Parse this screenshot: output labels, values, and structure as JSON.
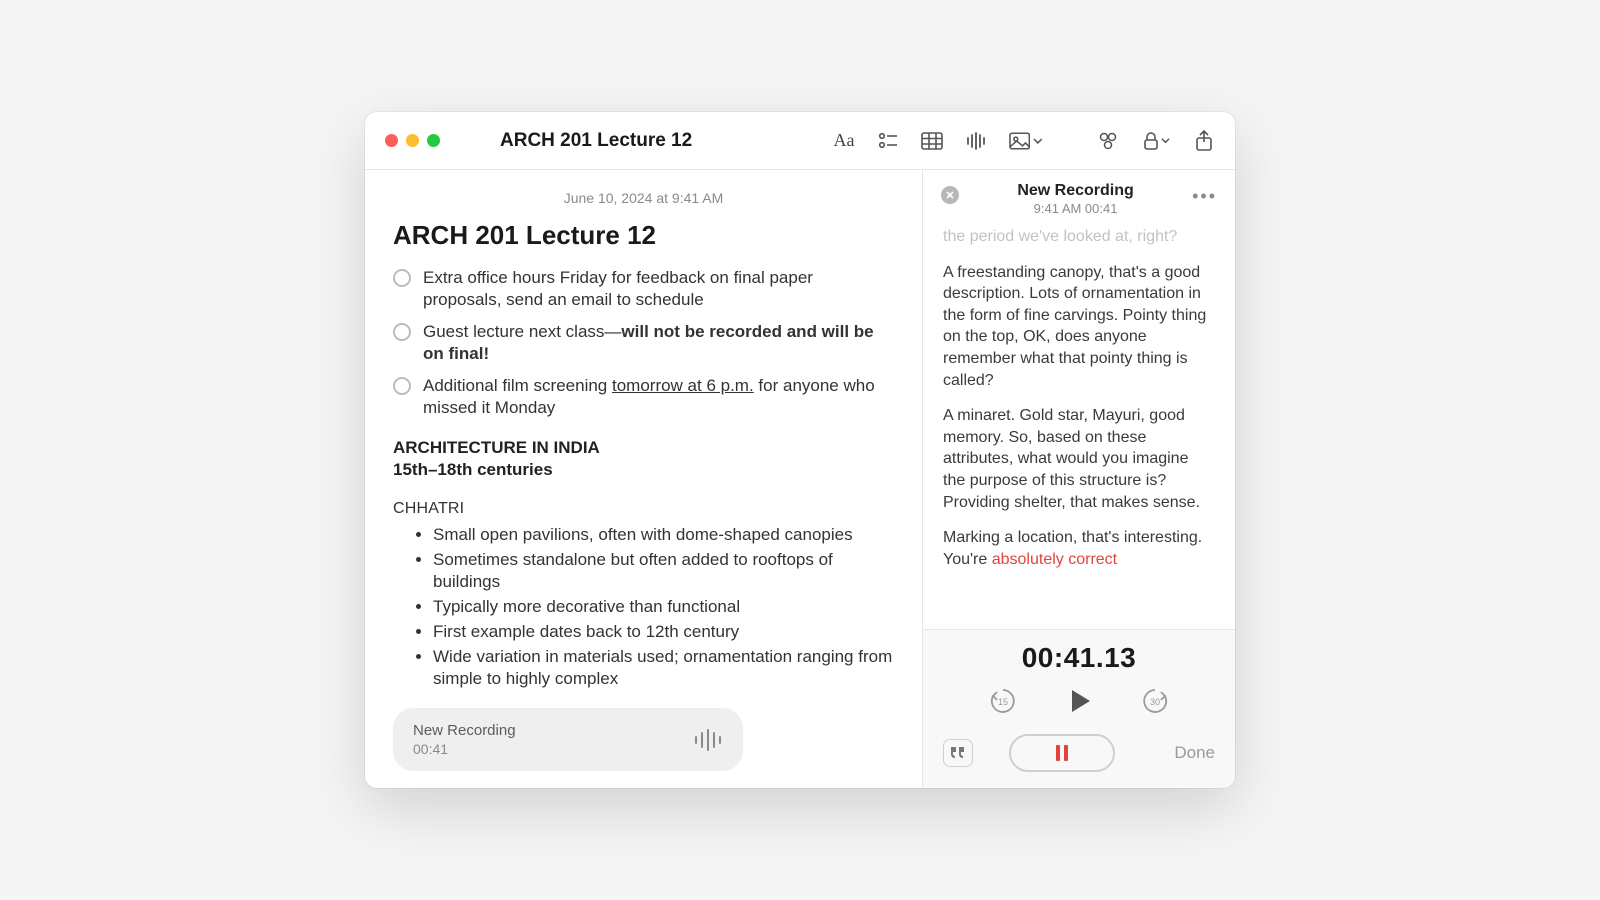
{
  "window": {
    "title": "ARCH 201 Lecture 12"
  },
  "toolbar": {
    "format_icon": "Aa",
    "checklist_icon": "checklist",
    "table_icon": "table",
    "audio_icon": "audio",
    "media_icon": "media",
    "link_icon": "link",
    "lock_icon": "lock",
    "share_icon": "share"
  },
  "note": {
    "timestamp": "June 10, 2024 at 9:41 AM",
    "title": "ARCH 201 Lecture 12",
    "checklist": [
      {
        "text_plain": "Extra office hours Friday for feedback on final paper proposals, send an email to schedule"
      },
      {
        "text_before": "Guest lecture next class—",
        "text_bold": "will not be recorded and will be on final!"
      },
      {
        "text_before": "Additional film screening ",
        "text_underline": "tomorrow at 6 p.m.",
        "text_after": " for anyone who missed it Monday"
      }
    ],
    "section_heading": "ARCHITECTURE IN INDIA",
    "section_sub": "15th–18th centuries",
    "topic_label": "CHHATRI",
    "bullets": [
      "Small open pavilions, often with dome-shaped canopies",
      "Sometimes standalone but often added to rooftops of buildings",
      "Typically more decorative than functional",
      "First example dates back to 12th century",
      "Wide variation in materials used; ornamentation ranging from simple to highly complex"
    ],
    "recording_chip": {
      "title": "New Recording",
      "duration": "00:41"
    }
  },
  "panel": {
    "title": "New Recording",
    "subtitle": "9:41 AM 00:41",
    "transcript": {
      "faded_line": "the period we've looked at, right?",
      "p1": "A freestanding canopy, that's a good description. Lots of ornamentation in the form of fine carvings. Pointy thing on the top, OK, does anyone remember what that pointy thing is called?",
      "p2": "A minaret. Gold star, Mayuri, good memory. So, based on these attributes, what would you imagine the purpose of this structure is? Providing shelter, that makes sense.",
      "p3_before": "Marking a location, that's interesting. You're ",
      "p3_highlight": "absolutely correct"
    },
    "controls": {
      "timer": "00:41.13",
      "skip_back_label": "15",
      "skip_fwd_label": "30",
      "done_label": "Done"
    }
  }
}
